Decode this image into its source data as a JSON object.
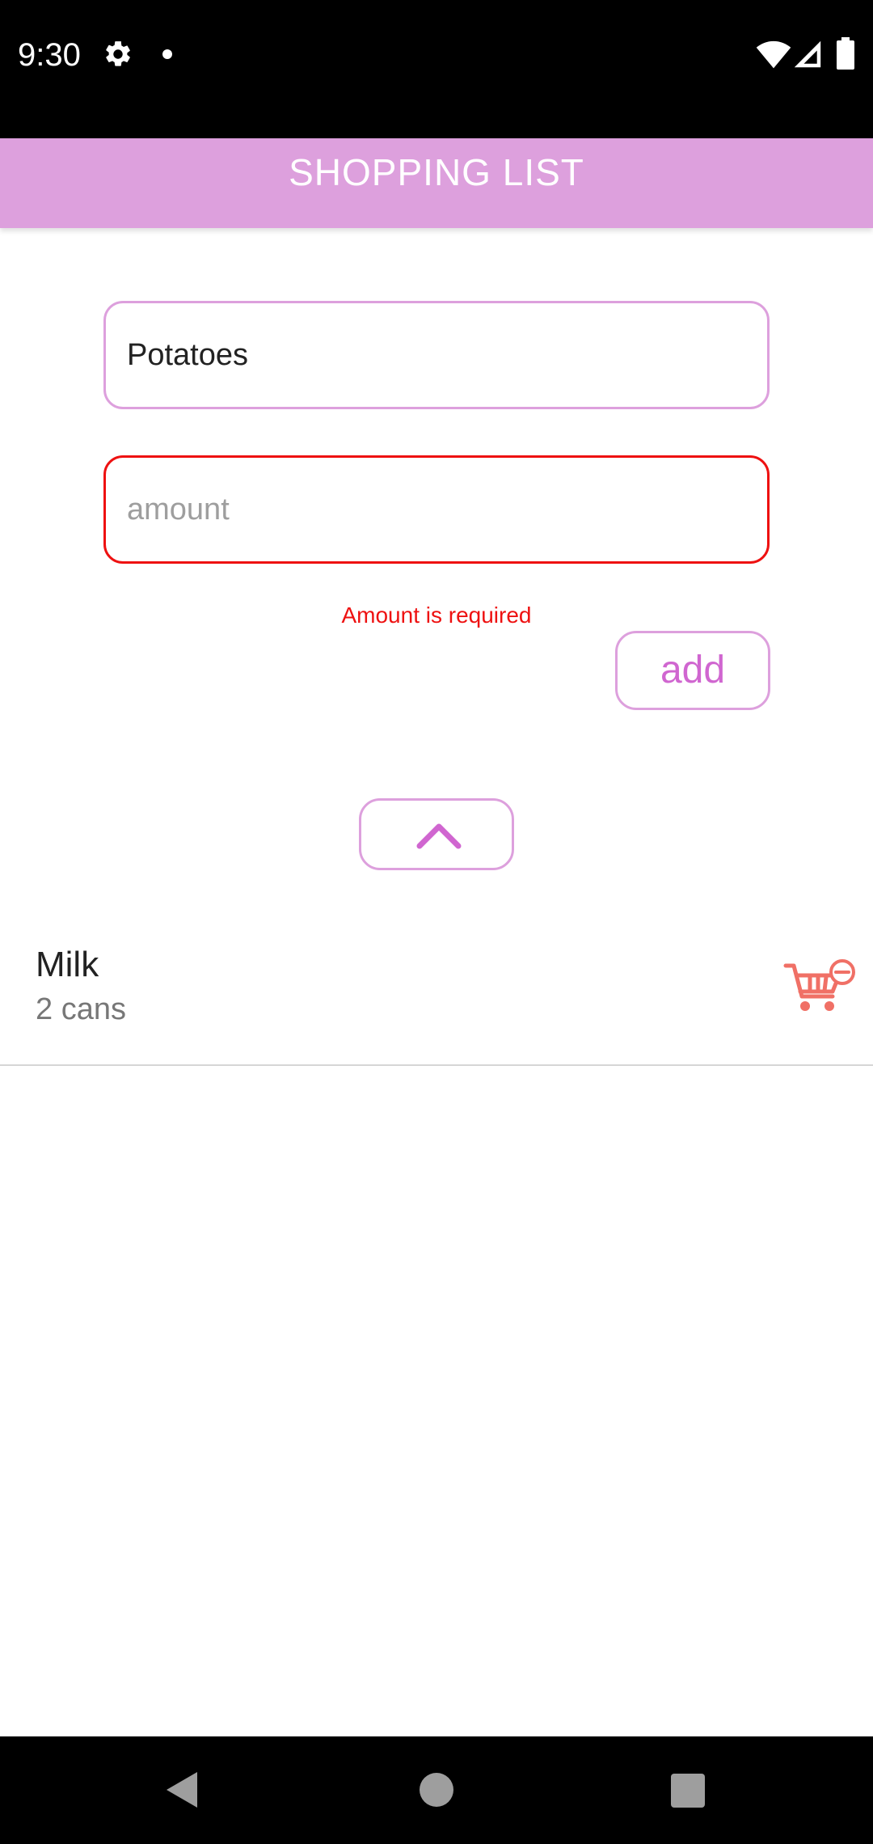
{
  "status_bar": {
    "time": "9:30",
    "icons": [
      "gear-icon",
      "dot-icon",
      "wifi-icon",
      "signal-icon",
      "battery-icon"
    ]
  },
  "app_bar": {
    "title": "SHOPPING LIST",
    "background_color": "#dda0dd"
  },
  "form": {
    "name_input": {
      "value": "Potatoes"
    },
    "amount_input": {
      "value": "",
      "placeholder": "amount"
    },
    "amount_error": "Amount is required",
    "add_button_label": "add",
    "collapse_button_icon": "chevron-up-icon"
  },
  "list": {
    "items": [
      {
        "name": "Milk",
        "amount": "2 cans",
        "action_icon": "remove-from-cart-icon"
      }
    ]
  },
  "nav_bar": {
    "icons": [
      "back-icon",
      "home-icon",
      "recents-icon"
    ]
  },
  "colors": {
    "accent": "#dda0dd",
    "accent_text": "#d066d0",
    "error": "#ee1111",
    "cart_icon": "#f07066"
  }
}
